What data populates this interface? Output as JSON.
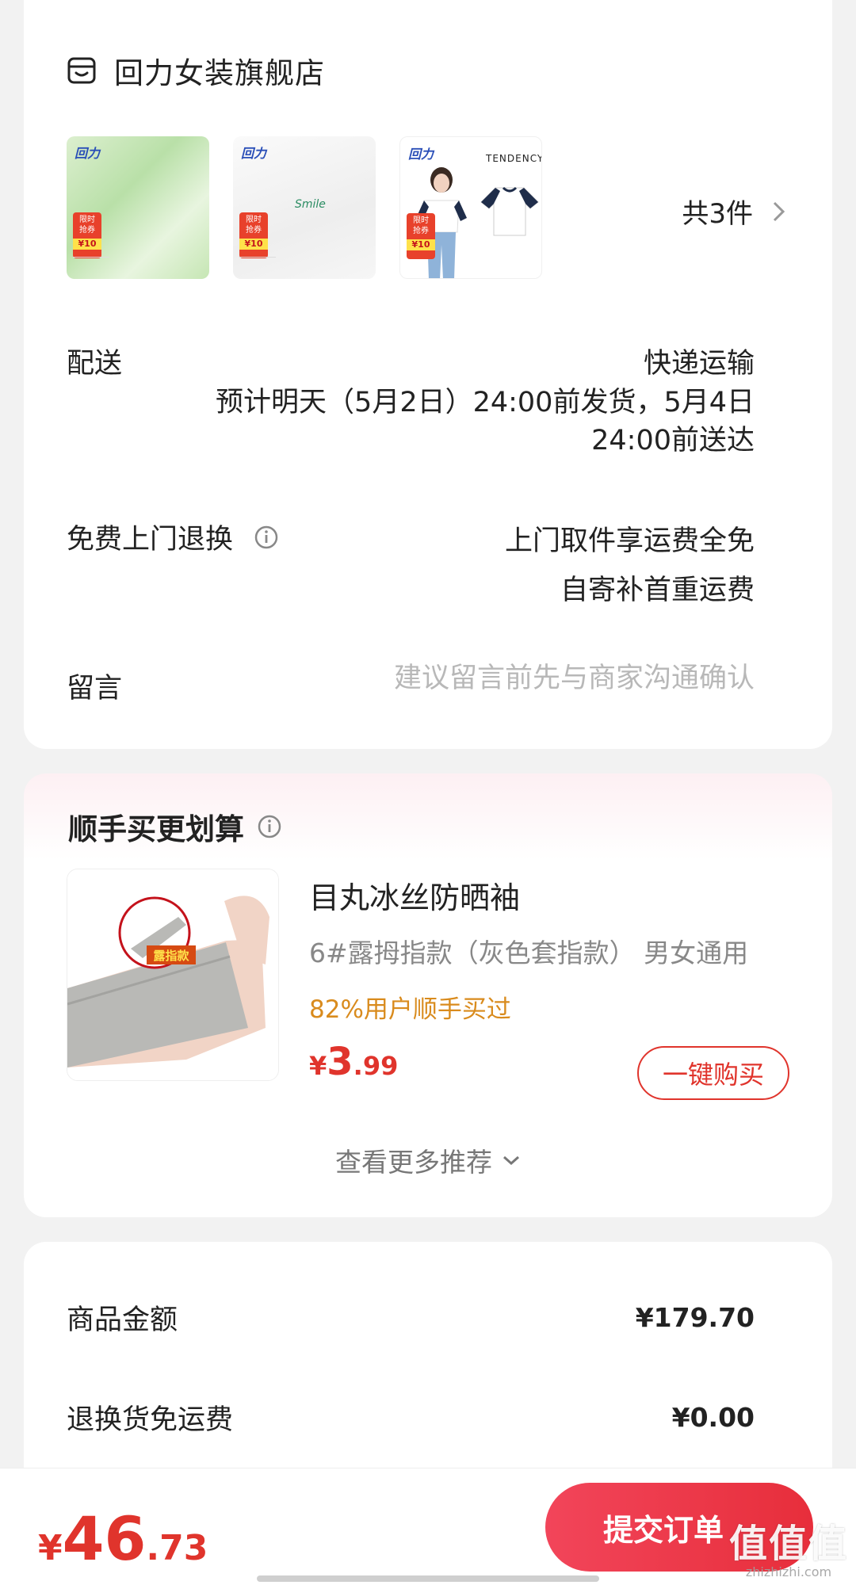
{
  "store": {
    "name": "回力女装旗舰店",
    "icon": "store-icon",
    "item_count": "共3件",
    "thumbnails": [
      {
        "brand": "回力",
        "promo_top": "限时",
        "promo_mid": "抢券",
        "promo_price": "¥10",
        "shirt_text": ""
      },
      {
        "brand": "回力",
        "promo_top": "限时",
        "promo_mid": "抢券",
        "promo_price": "¥10",
        "shirt_text": "Smile"
      },
      {
        "brand": "回力",
        "promo_top": "限时",
        "promo_mid": "抢券",
        "promo_price": "¥10",
        "tendency": "TENDENCY"
      }
    ]
  },
  "delivery": {
    "label": "配送",
    "method": "快递运输",
    "estimate_line1": "预计明天（5月2日）24:00前发货，5月4日",
    "estimate_line2": "24:00前送达"
  },
  "returns": {
    "label": "免费上门退换",
    "line1": "上门取件享运费全免",
    "line2": "自寄补首重运费"
  },
  "note": {
    "label": "留言",
    "placeholder": "建议留言前先与商家沟通确认"
  },
  "recommend": {
    "title": "顺手买更划算",
    "product_name": "目丸冰丝防晒袖",
    "spec": "6#露拇指款（灰色套指款）  男女通用",
    "badge": "露指款",
    "stat": "82%用户顺手买过",
    "price_currency": "¥",
    "price_int": "3",
    "price_dec": ".99",
    "buy_label": "一键购买",
    "more_label": "查看更多推荐"
  },
  "amounts": {
    "goods_label": "商品金额",
    "goods_value": "¥179.70",
    "freight_label": "退换货免运费",
    "freight_value": "¥0.00"
  },
  "footer": {
    "total_currency": "¥",
    "total_int": "46",
    "total_dec": ".73",
    "submit_label": "提交订单"
  },
  "watermark": {
    "big": "值值值",
    "small": "zhizhizhi.com"
  },
  "colors": {
    "accent": "#e0342c",
    "stat": "#d98b1d",
    "placeholder": "#b8b8b8"
  }
}
